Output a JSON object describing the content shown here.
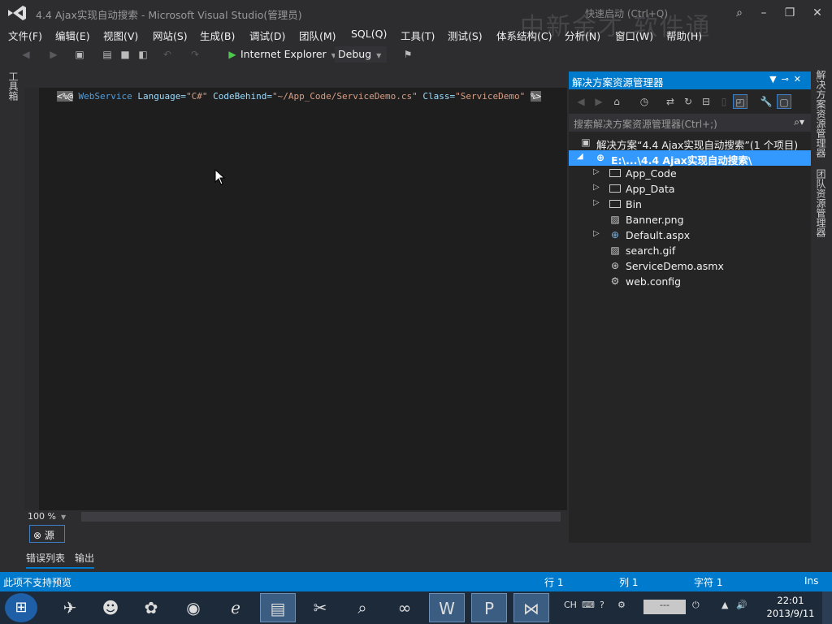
{
  "window": {
    "title": "4.4  Ajax实现自动搜索 - Microsoft Visual Studio(管理员)",
    "quick_launch": "快速启动 (Ctrl+Q)",
    "watermark": "中新金才 软件通"
  },
  "menu": [
    "文件(F)",
    "编辑(E)",
    "视图(V)",
    "网站(S)",
    "生成(B)",
    "调试(D)",
    "团队(M)",
    "SQL(Q)",
    "工具(T)",
    "测试(S)",
    "体系结构(C)",
    "分析(N)",
    "窗口(W)",
    "帮助(H)"
  ],
  "toolbar": {
    "run_target": "Internet Explorer",
    "config": "Debug"
  },
  "left_tab": "工具箱",
  "editor": {
    "directive_open": "<%@",
    "directive_name": "WebService",
    "attr1_name": "Language=",
    "attr1_value": "\"C#\"",
    "attr2_name": "CodeBehind=",
    "attr2_value": "\"~/App_Code/ServiceDemo.cs\"",
    "attr3_name": "Class=",
    "attr3_value": "\"ServiceDemo\"",
    "directive_close": "%>",
    "zoom": "100 %",
    "source_tab": "源"
  },
  "bottom_tabs": [
    "错误列表",
    "输出"
  ],
  "solution_explorer": {
    "title": "解决方案资源管理器",
    "search_placeholder": "搜索解决方案资源管理器(Ctrl+;)",
    "solution_label": "解决方案“4.4  Ajax实现自动搜索”(1 个项目)",
    "project_label": "E:\\...\\4.4  Ajax实现自动搜索\\",
    "items": [
      {
        "label": "App_Code",
        "icon": "folder-icon",
        "expandable": true
      },
      {
        "label": "App_Data",
        "icon": "folder-icon",
        "expandable": true
      },
      {
        "label": "Bin",
        "icon": "folder-icon",
        "expandable": true
      },
      {
        "label": "Banner.png",
        "icon": "image-file-icon",
        "expandable": false
      },
      {
        "label": "Default.aspx",
        "icon": "web-page-icon",
        "expandable": true
      },
      {
        "label": "search.gif",
        "icon": "image-file-icon",
        "expandable": false
      },
      {
        "label": "ServiceDemo.asmx",
        "icon": "web-service-icon",
        "expandable": false
      },
      {
        "label": "web.config",
        "icon": "config-file-icon",
        "expandable": false
      }
    ]
  },
  "right_tabs": [
    "解决方案资源管理器",
    "团队资源管理器"
  ],
  "status": {
    "message": "此项不支持预览",
    "line": "行 1",
    "col": "列 1",
    "char": "字符 1",
    "mode": "Ins"
  },
  "taskbar": {
    "ime": "CH",
    "clock_time": "22:01",
    "clock_date": "2013/9/11"
  },
  "colors": {
    "accent": "#007acc",
    "selection": "#3399ff",
    "background": "#2d2d30",
    "editor": "#1e1e1e"
  }
}
